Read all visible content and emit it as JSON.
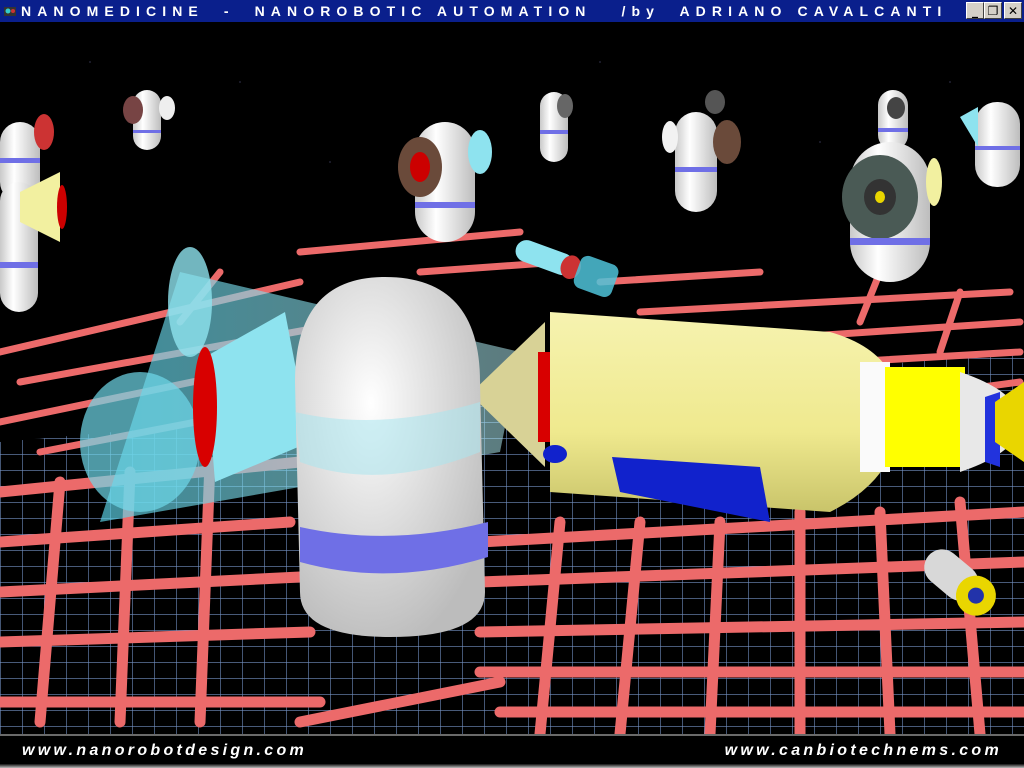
{
  "window": {
    "title": "NANOMEDICINE  -  NANOROBOTIC AUTOMATION   /by  ADRIANO CAVALCANTI",
    "buttons": {
      "minimize": "_",
      "maximize": "❐",
      "close": "✕"
    }
  },
  "footer": {
    "left_url": "www.nanorobotdesign.com",
    "right_url": "www.canbiotechnems.com"
  },
  "colors": {
    "titlebar": "#0a1f8c",
    "grid": "#7f9fd6",
    "fibers": "#ec6a6a",
    "nanorobot_white": "#f2f2f2",
    "band": "#6f6fe6",
    "capsule_yellow": "#f2f0a0",
    "cyan": "#8ee3ef"
  },
  "scene": {
    "objects": [
      "nanorobot-foreground",
      "yellow-capsule-robot",
      "cyan-transparent-robot",
      "floating-nanorobots",
      "small-probe-robots",
      "red-fiber-network",
      "blue-grid-floor"
    ]
  }
}
